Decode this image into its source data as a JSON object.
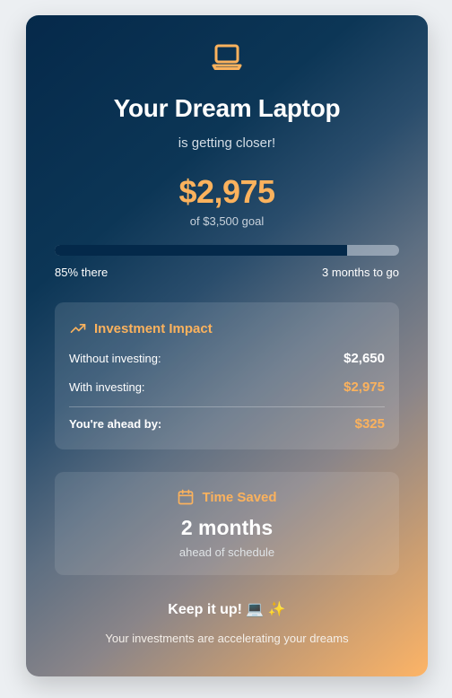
{
  "card": {
    "icon": "laptop-icon",
    "title": "Your Dream Laptop",
    "subtitle": "is getting closer!",
    "amount": "$2,975",
    "goal_text": "of $3,500 goal",
    "progress": {
      "percent": 85,
      "left_label": "85% there",
      "right_label": "3 months to go"
    }
  },
  "impact": {
    "icon": "trending-up-icon",
    "title": "Investment Impact",
    "rows": [
      {
        "label": "Without investing:",
        "value": "$2,650"
      },
      {
        "label": "With investing:",
        "value": "$2,975"
      },
      {
        "label": "You're ahead by:",
        "value": "$325"
      }
    ]
  },
  "time_saved": {
    "icon": "calendar-icon",
    "title": "Time Saved",
    "value": "2 months",
    "subtitle": "ahead of schedule"
  },
  "footer": {
    "headline": "Keep it up! 💻 ✨",
    "message": "Your investments are accelerating your dreams"
  },
  "colors": {
    "accent": "#fbb25d",
    "progress_fill": "#04294a",
    "card_start": "#05294a",
    "card_end": "#fdb466"
  }
}
